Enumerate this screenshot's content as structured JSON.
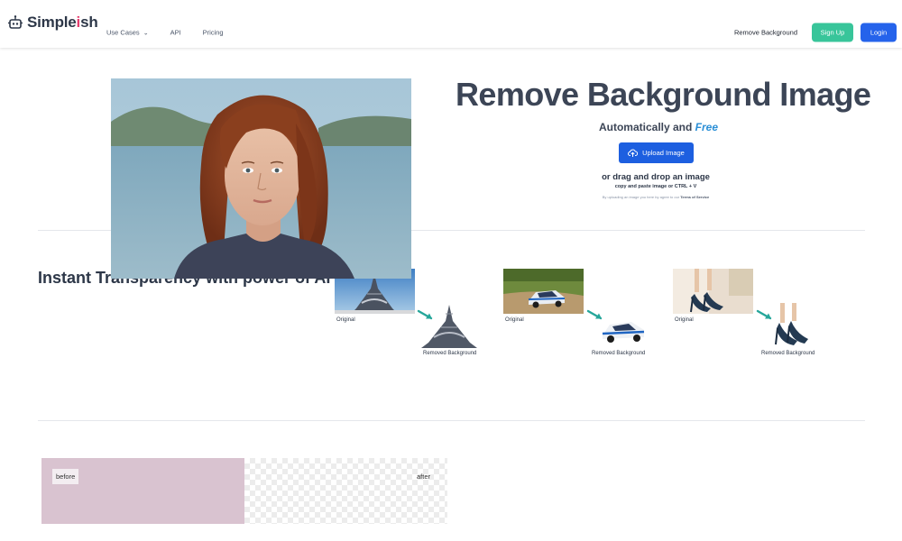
{
  "nav": {
    "brand_prefix": "Simple",
    "brand_dot": "i",
    "brand_suffix": "sh",
    "links": [
      "Use Cases",
      "API",
      "Pricing"
    ],
    "remove_background": "Remove Background",
    "signup": "Sign Up",
    "login": "Login"
  },
  "hero": {
    "title": "Remove Background Image",
    "subtitle_prefix": "Automatically and",
    "subtitle_free": "Free",
    "upload_label": "Upload Image",
    "drag_text": "or drag and drop an image",
    "paste_text": "copy and paste image or CTRL + V",
    "terms_prefix": "By uploading an image you here by agree to our",
    "terms_link": "Terms of Service"
  },
  "instant": {
    "title": "Instant Transparency with power of AI",
    "examples": [
      {
        "original_label": "Original",
        "removed_label": "Removed Background"
      },
      {
        "original_label": "Original",
        "removed_label": "Removed Background"
      },
      {
        "original_label": "Original",
        "removed_label": "Removed Background"
      }
    ]
  },
  "compare": {
    "before": "before",
    "after": "after"
  },
  "colors": {
    "primary": "#2563eb",
    "signup": "#38c59a",
    "free_accent": "#2b8fd6",
    "arrow": "#26a69a"
  },
  "icons": [
    "robot-logo-icon",
    "chevron-down-icon",
    "cloud-upload-icon",
    "arrow-right-icon"
  ]
}
